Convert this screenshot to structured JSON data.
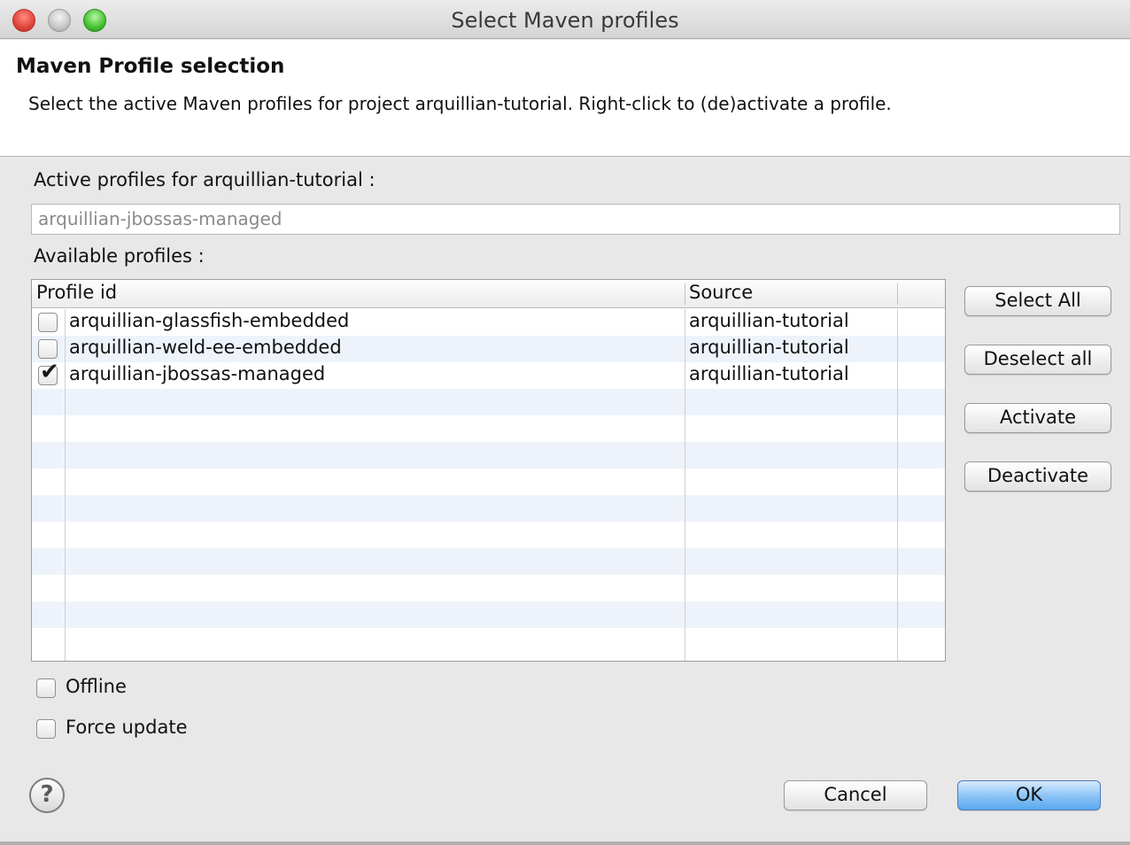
{
  "window": {
    "title": "Select Maven profiles"
  },
  "header": {
    "title": "Maven Profile selection",
    "description": "Select the active Maven profiles for project arquillian-tutorial. Right-click to (de)activate a profile."
  },
  "active_profiles": {
    "label": "Active profiles for arquillian-tutorial :",
    "value": "arquillian-jbossas-managed"
  },
  "available_profiles": {
    "label": "Available profiles :",
    "columns": [
      "Profile id",
      "Source"
    ],
    "rows": [
      {
        "profile_id": "arquillian-glassfish-embedded",
        "source": "arquillian-tutorial",
        "checked": false
      },
      {
        "profile_id": "arquillian-weld-ee-embedded",
        "source": "arquillian-tutorial",
        "checked": false
      },
      {
        "profile_id": "arquillian-jbossas-managed",
        "source": "arquillian-tutorial",
        "checked": true
      }
    ]
  },
  "side_buttons": {
    "select_all": "Select All",
    "deselect_all": "Deselect all",
    "activate": "Activate",
    "deactivate": "Deactivate"
  },
  "options": {
    "offline": {
      "label": "Offline",
      "checked": false
    },
    "force_update": {
      "label": "Force update",
      "checked": false
    }
  },
  "footer": {
    "help_glyph": "?",
    "cancel": "Cancel",
    "ok": "OK"
  },
  "icons": {
    "help": "help-icon",
    "check": "checkmark-icon"
  },
  "colors": {
    "primary_button": "#8ec5f7",
    "row_stripe": "#eef3fb",
    "close": "#e0443a",
    "minimize": "#c6c6c6",
    "maximize": "#43c22e"
  }
}
